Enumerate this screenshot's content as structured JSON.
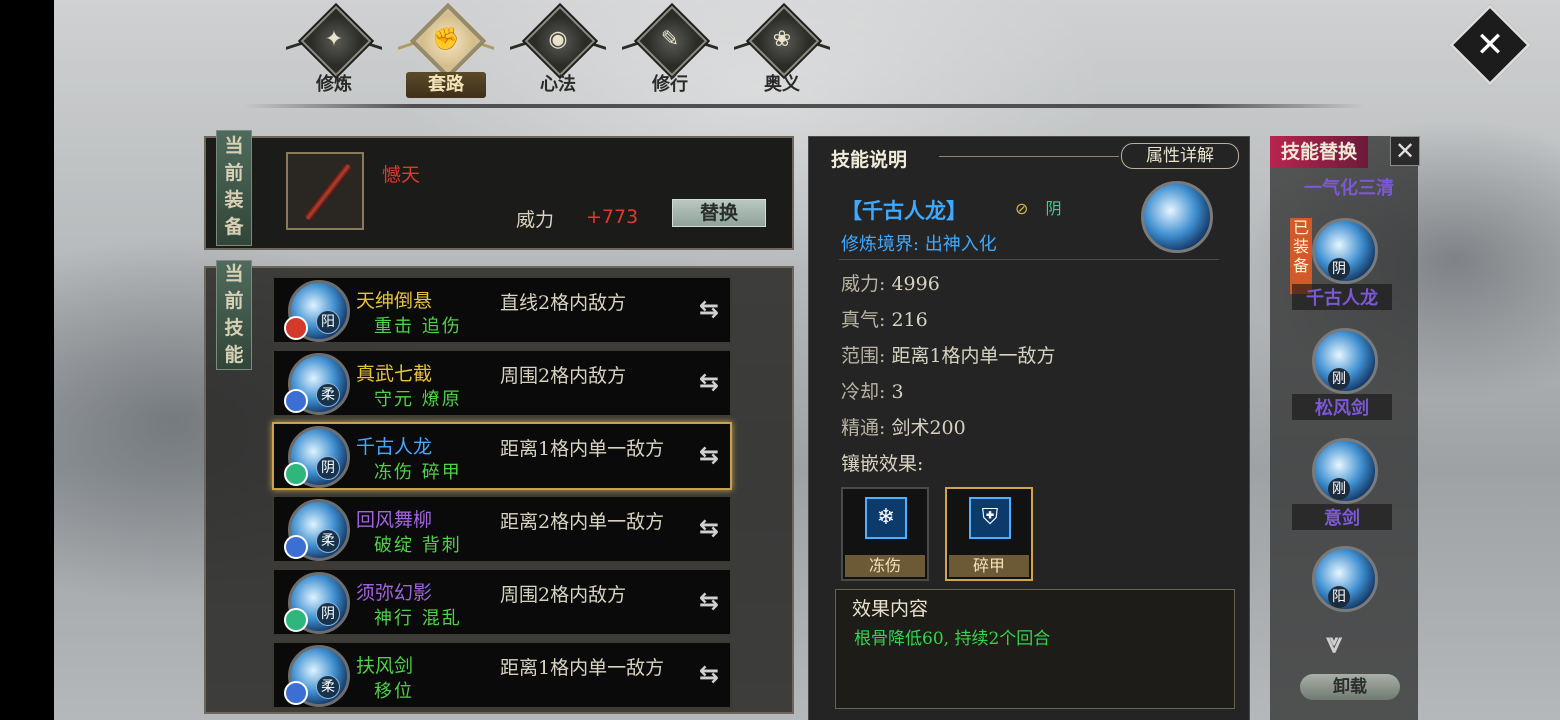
{
  "nav": {
    "tabs": [
      {
        "label": "修炼",
        "icon": "fire-emblem-icon"
      },
      {
        "label": "套路",
        "icon": "fist-emblem-icon"
      },
      {
        "label": "心法",
        "icon": "swirl-emblem-icon"
      },
      {
        "label": "修行",
        "icon": "scroll-emblem-icon"
      },
      {
        "label": "奥义",
        "icon": "lotus-emblem-icon"
      }
    ],
    "active_tab": "套路"
  },
  "equipment": {
    "tag": "当前装备",
    "weapon_name": "憾天",
    "power_label": "威力",
    "power_value": "+773",
    "replace_label": "替换"
  },
  "skills": {
    "tag": "当前技能",
    "rows": [
      {
        "name": "天绅倒悬",
        "name_color": "#e6c23c",
        "effects": "重击 追伤",
        "range": "直线2格内敌方",
        "attr": "阳",
        "element_color": "#d43a2c",
        "selected": false
      },
      {
        "name": "真武七截",
        "name_color": "#e6c23c",
        "effects": "守元 燎原",
        "range": "周围2格内敌方",
        "attr": "柔",
        "element_color": "#3c6fd4",
        "selected": false
      },
      {
        "name": "千古人龙",
        "name_color": "#4aa6ff",
        "effects": "冻伤 碎甲",
        "range": "距离1格内单一敌方",
        "attr": "阴",
        "element_color": "#2fb67c",
        "selected": true
      },
      {
        "name": "回风舞柳",
        "name_color": "#a064e0",
        "effects": "破绽 背刺",
        "range": "距离2格内单一敌方",
        "attr": "柔",
        "element_color": "#3c6fd4",
        "selected": false
      },
      {
        "name": "须弥幻影",
        "name_color": "#a064e0",
        "effects": "神行 混乱",
        "range": "周围2格内敌方",
        "attr": "阴",
        "element_color": "#2fb67c",
        "selected": false
      },
      {
        "name": "扶风剑",
        "name_color": "#4fd04b",
        "effects": "移位",
        "range": "距离1格内单一敌方",
        "attr": "柔",
        "element_color": "#3c6fd4",
        "selected": false
      }
    ]
  },
  "description": {
    "title": "技能说明",
    "attr_detail_label": "属性详解",
    "skill_name": "【千古人龙】",
    "badge_1": "⊘",
    "badge_2": "阴",
    "realm": "修炼境界: 出神入化",
    "stats": [
      {
        "key": "威力:",
        "value": "4996"
      },
      {
        "key": "真气:",
        "value": "216"
      },
      {
        "key": "范围:",
        "value": "距离1格内单一敌方"
      },
      {
        "key": "冷却:",
        "value": "3"
      },
      {
        "key": "精通:",
        "value": "剑术200"
      }
    ],
    "inlay_label": "镶嵌效果:",
    "gems": [
      {
        "label": "冻伤",
        "icon": "snowflake-icon",
        "glyph": "❄"
      },
      {
        "label": "碎甲",
        "icon": "broken-shield-icon",
        "glyph": "⛨"
      }
    ],
    "effect_title": "效果内容",
    "effect_text": "根骨降低60, 持续2个回合"
  },
  "replace": {
    "title": "技能替换",
    "close": "✕",
    "top_partial": "一气化三清",
    "equipped_tag": "已装备",
    "candidates": [
      {
        "name": "千古人龙",
        "attr": "阴",
        "equipped": true
      },
      {
        "name": "松风剑",
        "attr": "刚",
        "equipped": false
      },
      {
        "name": "意剑",
        "attr": "刚",
        "equipped": false
      },
      {
        "name": "",
        "attr": "阳",
        "equipped": false
      }
    ],
    "scroll_glyph": "⩔",
    "unload_label": "卸载"
  }
}
